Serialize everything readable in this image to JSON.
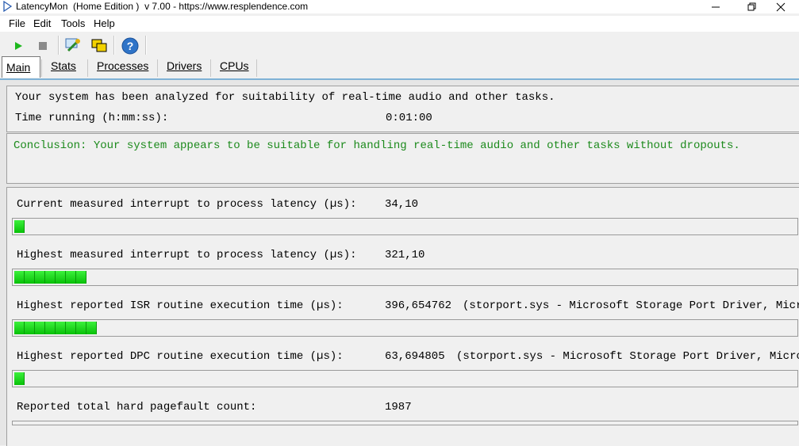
{
  "window": {
    "title": "LatencyMon  (Home Edition )  v 7.00 - https://www.resplendence.com"
  },
  "menu": {
    "items": [
      {
        "label": "File"
      },
      {
        "label": "Edit"
      },
      {
        "label": "Tools"
      },
      {
        "label": "Help"
      }
    ]
  },
  "toolbar": {
    "icons": [
      "play-icon",
      "stop-icon",
      "analyze-icon",
      "windows-icon",
      "help-icon"
    ]
  },
  "tabs": [
    {
      "label": "Main"
    },
    {
      "label": "Stats"
    },
    {
      "label": "Processes"
    },
    {
      "label": "Drivers"
    },
    {
      "label": "CPUs"
    }
  ],
  "main": {
    "summary_line": "Your system has been analyzed for suitability of real-time audio and other tasks.",
    "time_label": "Time running (h:mm:ss):",
    "time_value": "0:01:00",
    "conclusion": "Conclusion: Your system appears to be suitable for handling real-time audio and other tasks without dropouts.",
    "metrics": [
      {
        "label": "Current measured interrupt to process latency (µs):",
        "value": "34,10",
        "detail": "",
        "bar_segments": 1
      },
      {
        "label": "Highest measured interrupt to process latency (µs):",
        "value": "321,10",
        "detail": "",
        "bar_segments": 7
      },
      {
        "label": "Highest reported ISR routine execution time (µs):",
        "value": "396,654762",
        "detail": "(storport.sys - Microsoft Storage Port Driver, Micros",
        "bar_segments": 8
      },
      {
        "label": "Highest reported DPC routine execution time (µs):",
        "value": "63,694805",
        "detail": "(storport.sys - Microsoft Storage Port Driver, Microso",
        "bar_segments": 1
      }
    ],
    "pagefault": {
      "label": "Reported total hard pagefault count:",
      "value": "1987"
    }
  },
  "colors": {
    "conclusion_green": "#1c8a1c",
    "bar_green": "#22d822",
    "frame_blue": "#7fb2d6"
  }
}
